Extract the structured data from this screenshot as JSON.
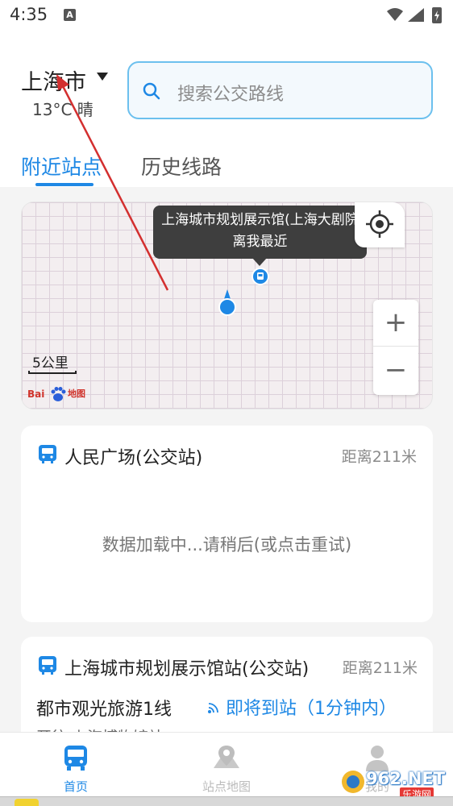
{
  "status_bar": {
    "time": "4:35",
    "notification_letter": "A"
  },
  "header": {
    "city": "上海市",
    "weather": "13°C 晴",
    "search_placeholder": "搜索公交路线",
    "tabs": [
      {
        "label": "附近站点",
        "active": true
      },
      {
        "label": "历史线路",
        "active": false
      }
    ]
  },
  "map": {
    "tooltip_line1": "上海城市规划展示馆(上海大剧院",
    "tooltip_line2": "离我最近",
    "zoom_in": "+",
    "zoom_out": "−",
    "scale": "5公里",
    "logo_text": "Bai",
    "logo_text2": "地图"
  },
  "stations": [
    {
      "name": "人民广场(公交站)",
      "distance": "距离211米",
      "loading_text": "数据加载中...请稍后(或点击重试)"
    },
    {
      "name": "上海城市规划展示馆站(公交站)",
      "distance": "距离211米",
      "route": "都市观光旅游1线",
      "arrival": "即将到站（1分钟内）",
      "direction": "开往 上海博物馆站"
    }
  ],
  "bottom_nav": [
    {
      "label": "首页",
      "icon": "bus-icon",
      "active": true
    },
    {
      "label": "站点地图",
      "icon": "map-pin-icon",
      "active": false
    },
    {
      "label": "我的",
      "icon": "user-icon",
      "active": false
    }
  ],
  "watermark": {
    "text": "962.NET",
    "sub": "乐游网"
  },
  "colors": {
    "accent": "#1e88e5",
    "search_border": "#6cc0ee",
    "annotation_arrow": "#d32f2f"
  }
}
